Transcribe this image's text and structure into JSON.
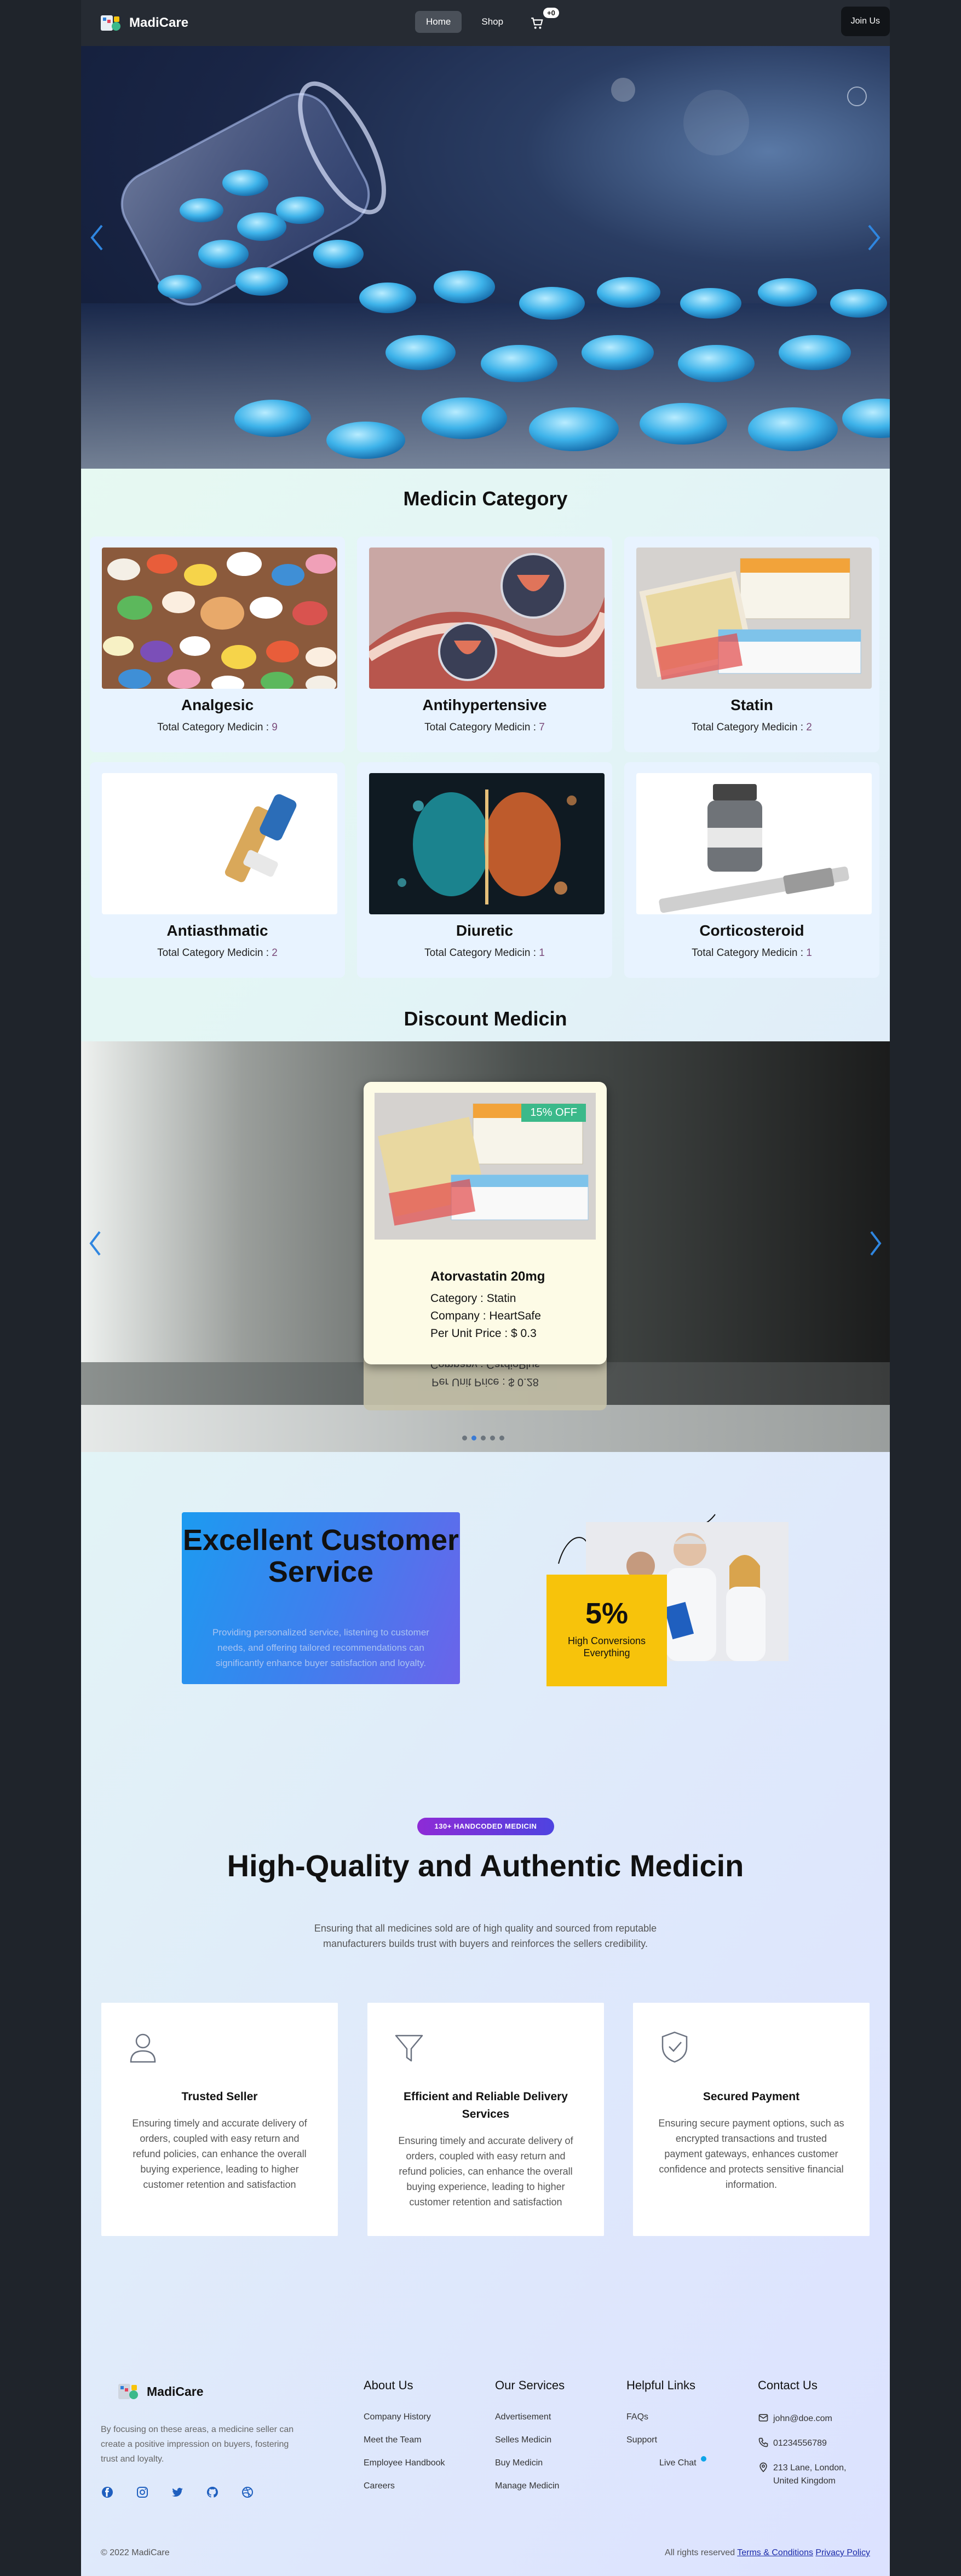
{
  "nav": {
    "brand": "MadiCare",
    "links": [
      "Home",
      "Shop"
    ],
    "cart_badge": "+0",
    "join": "Join Us"
  },
  "category": {
    "title": "Medicin Category",
    "count_label": "Total Category Medicin :",
    "items": [
      {
        "name": "Analgesic",
        "count": "9"
      },
      {
        "name": "Antihypertensive",
        "count": "7"
      },
      {
        "name": "Statin",
        "count": "2"
      },
      {
        "name": "Antiasthmatic",
        "count": "2"
      },
      {
        "name": "Diuretic",
        "count": "1"
      },
      {
        "name": "Corticosteroid",
        "count": "1"
      }
    ]
  },
  "discount": {
    "title": "Discount Medicin",
    "badge": "15% OFF",
    "name": "Atorvastatin 20mg",
    "category": "Category : Statin",
    "company": "Company : HeartSafe",
    "price": "Per Unit Price : $ 0.3",
    "ghost_line1": "Company : CardioPlus",
    "ghost_line2": "Per Unit Price : $ 0.28"
  },
  "service": {
    "title": "Excellent Customer Service",
    "text": "Providing personalized service, listening to customer needs, and offering tailored recommendations can significantly enhance buyer satisfaction and loyalty.",
    "percent": "5%",
    "percent_label": "High Conversions Everything"
  },
  "quality": {
    "pill": "130+ HANDCODED MEDICIN",
    "title": "High-Quality and Authentic Medicin",
    "subtitle": "Ensuring that all medicines sold are of high quality and sourced from reputable manufacturers builds trust with buyers and reinforces the sellers credibility.",
    "features": [
      {
        "title": "Trusted Seller",
        "text": "Ensuring timely and accurate delivery of orders, coupled with easy return and refund policies, can enhance the overall buying experience, leading to higher customer retention and satisfaction"
      },
      {
        "title": "Efficient and Reliable Delivery Services",
        "text": "Ensuring timely and accurate delivery of orders, coupled with easy return and refund policies, can enhance the overall buying experience, leading to higher customer retention and satisfaction"
      },
      {
        "title": "Secured Payment",
        "text": "Ensuring secure payment options, such as encrypted transactions and trusted payment gateways, enhances customer confidence and protects sensitive financial information."
      }
    ]
  },
  "footer": {
    "brand": "MadiCare",
    "desc": "By focusing on these areas, a medicine seller can create a positive impression on buyers, fostering trust and loyalty.",
    "about": {
      "title": "About Us",
      "items": [
        "Company History",
        "Meet the Team",
        "Employee Handbook",
        "Careers"
      ]
    },
    "services": {
      "title": "Our Services",
      "items": [
        "Advertisement",
        "Selles Medicin",
        "Buy Medicin",
        "Manage Medicin"
      ]
    },
    "help": {
      "title": "Helpful Links",
      "items": [
        "FAQs",
        "Support",
        "Live Chat"
      ]
    },
    "contact": {
      "title": "Contact Us",
      "email": "john@doe.com",
      "phone": "01234556789",
      "address": "213 Lane, London, United Kingdom"
    },
    "copyright": "© 2022 MadiCare",
    "rights": "All rights reserved",
    "terms": "Terms & Conditions",
    "privacy": "Privacy Policy"
  }
}
